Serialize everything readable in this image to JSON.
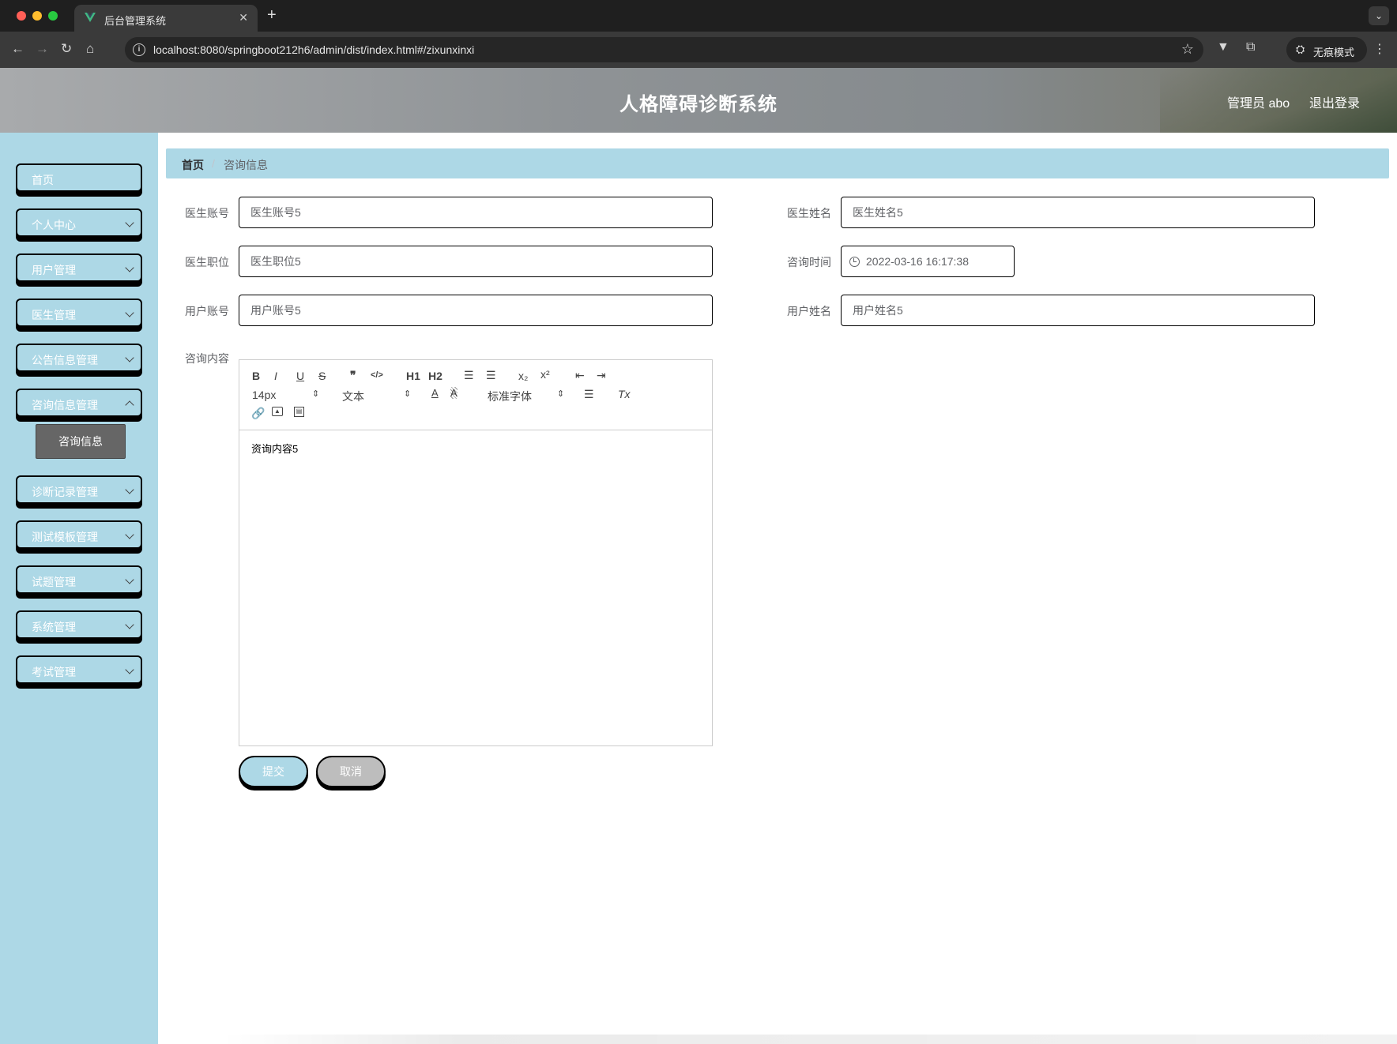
{
  "browser": {
    "tab_title": "后台管理系统",
    "url": "localhost:8080/springboot212h6/admin/dist/index.html#/zixunxinxi",
    "incognito_label": "无痕模式"
  },
  "header": {
    "title": "人格障碍诊断系统",
    "user": "管理员 abo",
    "logout": "退出登录"
  },
  "sidebar": {
    "items": [
      {
        "label": "首页",
        "has_children": false
      },
      {
        "label": "个人中心",
        "has_children": true
      },
      {
        "label": "用户管理",
        "has_children": true
      },
      {
        "label": "医生管理",
        "has_children": true
      },
      {
        "label": "公告信息管理",
        "has_children": true
      },
      {
        "label": "咨询信息管理",
        "has_children": true
      },
      {
        "label": "诊断记录管理",
        "has_children": true
      },
      {
        "label": "测试模板管理",
        "has_children": true
      },
      {
        "label": "试题管理",
        "has_children": true
      },
      {
        "label": "系统管理",
        "has_children": true
      },
      {
        "label": "考试管理",
        "has_children": true
      }
    ],
    "active_submenu": "咨询信息"
  },
  "breadcrumb": {
    "home": "首页",
    "separator": "/",
    "current": "咨询信息"
  },
  "form": {
    "doctor_account": {
      "label": "医生账号",
      "value": "医生账号5"
    },
    "doctor_name": {
      "label": "医生姓名",
      "value": "医生姓名5"
    },
    "doctor_position": {
      "label": "医生职位",
      "value": "医生职位5"
    },
    "consult_time": {
      "label": "咨询时间",
      "value": "2022-03-16 16:17:38"
    },
    "user_account": {
      "label": "用户账号",
      "value": "用户账号5"
    },
    "user_name": {
      "label": "用户姓名",
      "value": "用户姓名5"
    },
    "content": {
      "label": "咨询内容",
      "value": "资询内容5"
    }
  },
  "editor_toolbar": {
    "bold": "B",
    "italic": "I",
    "underline": "U",
    "strike": "S",
    "quote": "❞",
    "code": "</>",
    "h1": "H1",
    "h2": "H2",
    "ordered_list": "☰",
    "bullet_list": "☰",
    "subscript": "x₂",
    "superscript": "x²",
    "outdent": "⇤",
    "indent": "⇥",
    "size": "14px",
    "header_select": "文本",
    "font": "标准字体",
    "clean": "Tx"
  },
  "buttons": {
    "submit": "提交",
    "cancel": "取消"
  },
  "colors": {
    "sidebar_bg": "#add8e6",
    "active_submenu_bg": "#666666",
    "cancel_bg": "#bdbdbd"
  }
}
